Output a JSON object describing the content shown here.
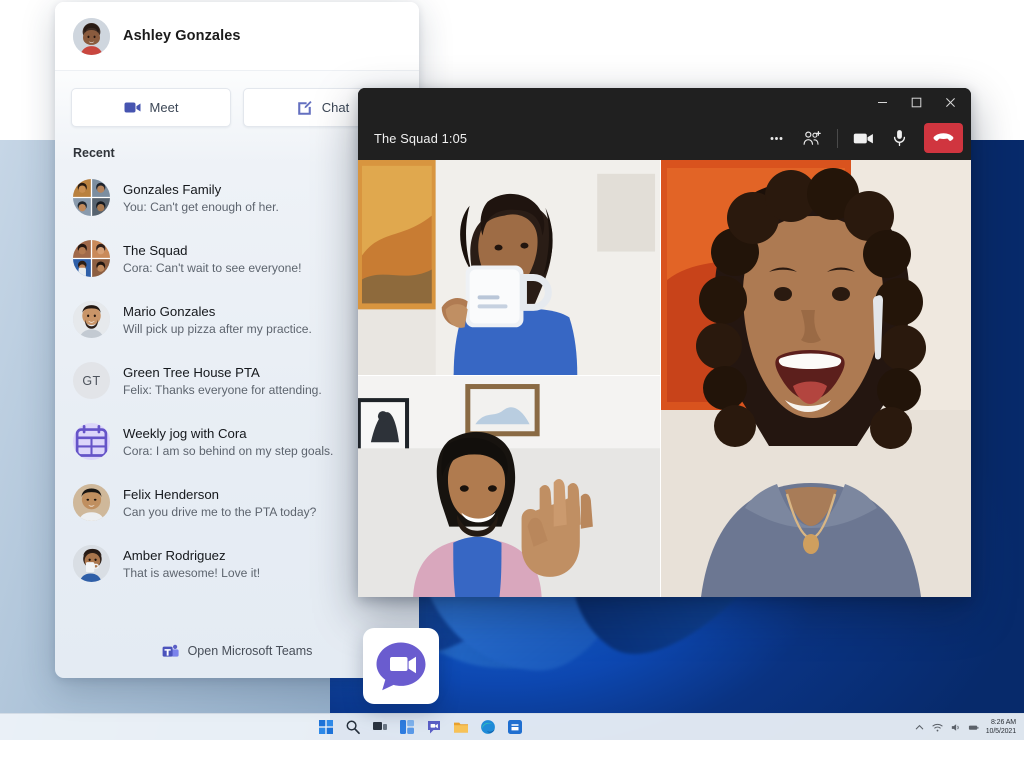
{
  "user": {
    "name": "Ashley Gonzales",
    "avatar_icon": "avatar-ashley"
  },
  "actions": {
    "meet": {
      "label": "Meet",
      "icon": "video-camera-icon"
    },
    "chat": {
      "label": "Chat",
      "icon": "compose-chat-icon"
    }
  },
  "recent": {
    "heading": "Recent",
    "items": [
      {
        "title": "Gonzales Family",
        "preview": "You: Can't get enough of her.",
        "avatar_type": "group-photo",
        "avatar_icon": "avatar-gonzales-family"
      },
      {
        "title": "The Squad",
        "preview": "Cora: Can't wait to see everyone!",
        "avatar_type": "group-photo",
        "avatar_icon": "avatar-the-squad"
      },
      {
        "title": "Mario Gonzales",
        "preview": "Will pick up pizza after my practice.",
        "avatar_type": "photo",
        "avatar_icon": "avatar-mario-gonzales"
      },
      {
        "title": "Green Tree House PTA",
        "preview": "Felix: Thanks everyone for attending.",
        "avatar_type": "initials",
        "initials": "GT",
        "avatar_icon": "avatar-initials-gt"
      },
      {
        "title": "Weekly jog with Cora",
        "preview": "Cora: I am so behind on my step goals.",
        "avatar_type": "icon",
        "avatar_icon": "calendar-icon"
      },
      {
        "title": "Felix Henderson",
        "preview": "Can you drive me to the PTA today?",
        "avatar_type": "photo",
        "avatar_icon": "avatar-felix-henderson"
      },
      {
        "title": "Amber Rodriguez",
        "preview": "That is awesome! Love it!",
        "avatar_type": "photo",
        "avatar_icon": "avatar-amber-rodriguez"
      }
    ]
  },
  "footer": {
    "label": "Open Microsoft Teams",
    "icon": "microsoft-teams-icon"
  },
  "meeting": {
    "title": "The Squad 1:05",
    "window_buttons": {
      "minimize": "minimize-icon",
      "maximize": "maximize-icon",
      "close": "close-icon"
    },
    "controls": [
      {
        "name": "more-options-button",
        "icon": "ellipsis-icon"
      },
      {
        "name": "add-people-button",
        "icon": "add-people-icon"
      },
      {
        "name": "camera-toggle-button",
        "icon": "camera-icon"
      },
      {
        "name": "microphone-toggle-button",
        "icon": "microphone-icon"
      },
      {
        "name": "hangup-button",
        "icon": "hangup-phone-icon"
      }
    ],
    "participants": [
      {
        "position": "top-left",
        "label": "participant-video-coffee-woman"
      },
      {
        "position": "bottom-left",
        "label": "participant-video-waving-man"
      },
      {
        "position": "right",
        "label": "participant-video-laughing-woman"
      }
    ]
  },
  "desktop": {
    "chat_app_icon": "windows-chat-app-icon",
    "taskbar": {
      "icons": [
        "start-icon",
        "search-icon",
        "task-view-icon",
        "widgets-icon",
        "chat-icon",
        "file-explorer-icon",
        "edge-icon",
        "microsoft-store-icon"
      ],
      "tray": {
        "icons": [
          "chevron-up-icon",
          "wifi-icon",
          "volume-icon",
          "battery-icon"
        ],
        "time": "8:26 AM",
        "date": "10/5/2021"
      }
    }
  },
  "colors": {
    "accent_blue": "#4654b0",
    "teams_purple": "#5b5fc7",
    "hangup_red": "#d0353f",
    "window_chrome": "#202020",
    "panel_bg": "#e7edf4"
  }
}
